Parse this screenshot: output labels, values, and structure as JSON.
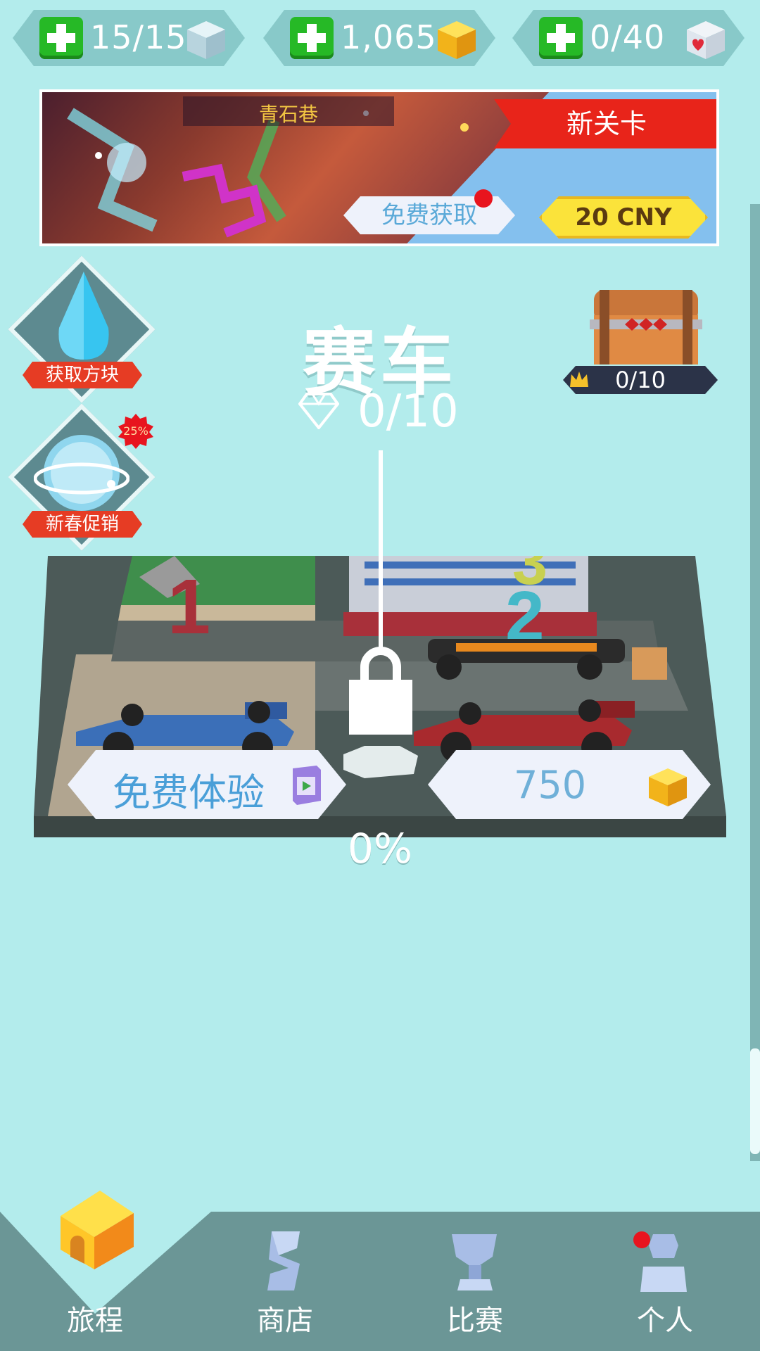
{
  "top_bar": {
    "energy": {
      "value": "15/15",
      "icon": "ice-cube-icon"
    },
    "coins": {
      "value": "1,065",
      "icon": "gold-cube-icon"
    },
    "hearts": {
      "value": "0/40",
      "icon": "heart-cube-icon"
    }
  },
  "banner": {
    "title": "青石巷",
    "tag": "新关卡",
    "free_button": "免费获取",
    "price_button": "20 CNY"
  },
  "side_actions": [
    {
      "label": "获取方块",
      "icon": "water-drop-icon"
    },
    {
      "label": "新春促销",
      "icon": "planet-icon",
      "badge": "25%"
    }
  ],
  "level": {
    "title": "赛车",
    "gems": "0/10",
    "chest_count": "0/10",
    "free_trial_button": "免费体验",
    "price": "750",
    "progress": "0%",
    "progress_value": 0
  },
  "nav": {
    "items": [
      {
        "label": "旅程",
        "icon": "house-icon",
        "active": true
      },
      {
        "label": "商店",
        "icon": "shop-icon",
        "active": false
      },
      {
        "label": "比赛",
        "icon": "trophy-icon",
        "active": false
      },
      {
        "label": "个人",
        "icon": "profile-icon",
        "active": false
      }
    ]
  },
  "colors": {
    "background": "#b3ecec",
    "accent_red": "#e8241a",
    "price_yellow": "#fbe33a",
    "nav_bg": "#6b9696"
  }
}
